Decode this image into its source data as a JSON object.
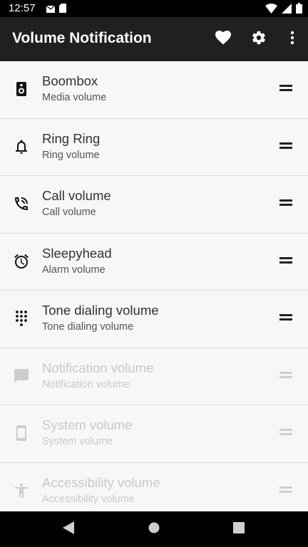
{
  "status_bar": {
    "time": "12:57",
    "left_icons": [
      "mail-icon",
      "sd-card-icon"
    ],
    "right_icons": [
      "wifi-icon",
      "signal-icon",
      "battery-icon"
    ]
  },
  "app_bar": {
    "title": "Volume Notification",
    "actions": [
      "heart-icon",
      "settings-icon",
      "more-vert-icon"
    ]
  },
  "volume_list": [
    {
      "title": "Boombox",
      "subtitle": "Media volume",
      "icon": "speaker-icon",
      "enabled": true
    },
    {
      "title": "Ring Ring",
      "subtitle": "Ring volume",
      "icon": "bell-icon",
      "enabled": true
    },
    {
      "title": "Call volume",
      "subtitle": "Call volume",
      "icon": "phone-call-icon",
      "enabled": true
    },
    {
      "title": "Sleepyhead",
      "subtitle": "Alarm volume",
      "icon": "alarm-icon",
      "enabled": true
    },
    {
      "title": "Tone dialing volume",
      "subtitle": "Tone dialing volume",
      "icon": "dialpad-icon",
      "enabled": true
    },
    {
      "title": "Notification volume",
      "subtitle": "Notification volume",
      "icon": "message-icon",
      "enabled": false
    },
    {
      "title": "System volume",
      "subtitle": "System volume",
      "icon": "phone-device-icon",
      "enabled": false
    },
    {
      "title": "Accessibility volume",
      "subtitle": "Accessibility volume",
      "icon": "accessibility-icon",
      "enabled": false
    }
  ],
  "nav_bar": [
    "back-icon",
    "home-icon",
    "recents-icon"
  ],
  "colors": {
    "app_bar": "#202020",
    "list_background": "#f7f7f7",
    "enabled_text": "#333333",
    "disabled_text": "#c8c8c8"
  }
}
